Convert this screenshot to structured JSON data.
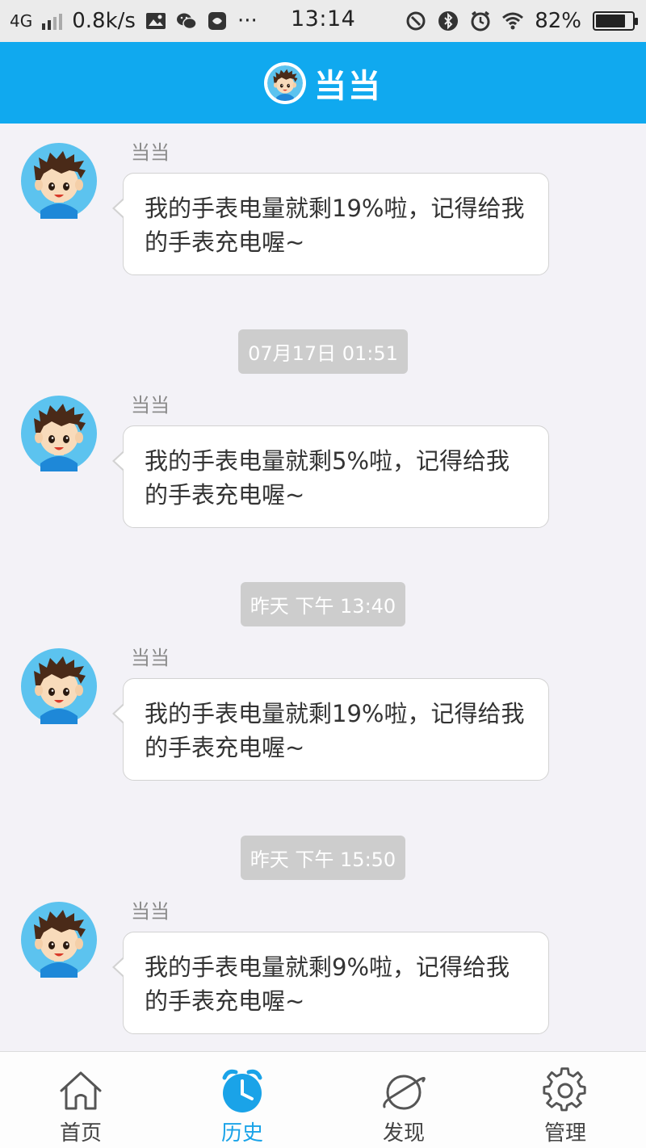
{
  "status_bar": {
    "network": "4G",
    "speed": "0.8k/s",
    "more": "···",
    "time": "13:14",
    "battery_percent": "82%",
    "battery_level": 0.82
  },
  "header": {
    "title": "当当"
  },
  "messages": [
    {
      "sender": "当当",
      "text": "我的手表电量就剩19%啦，记得给我的手表充电喔~"
    },
    {
      "timestamp": "07月17日 01:51",
      "sender": "当当",
      "text": "我的手表电量就剩5%啦，记得给我的手表充电喔~"
    },
    {
      "timestamp": "昨天 下午 13:40",
      "sender": "当当",
      "text": "我的手表电量就剩19%啦，记得给我的手表充电喔~"
    },
    {
      "timestamp": "昨天 下午 15:50",
      "sender": "当当",
      "text": "我的手表电量就剩9%啦，记得给我的手表充电喔~"
    }
  ],
  "tabbar": {
    "items": [
      {
        "label": "首页",
        "icon": "home-icon"
      },
      {
        "label": "历史",
        "icon": "alarm-clock-icon",
        "active": true
      },
      {
        "label": "发现",
        "icon": "planet-icon"
      },
      {
        "label": "管理",
        "icon": "gear-icon"
      }
    ]
  },
  "colors": {
    "brand": "#10a9ef",
    "active_tab": "#1aa3e8",
    "background": "#f3f2f7"
  }
}
